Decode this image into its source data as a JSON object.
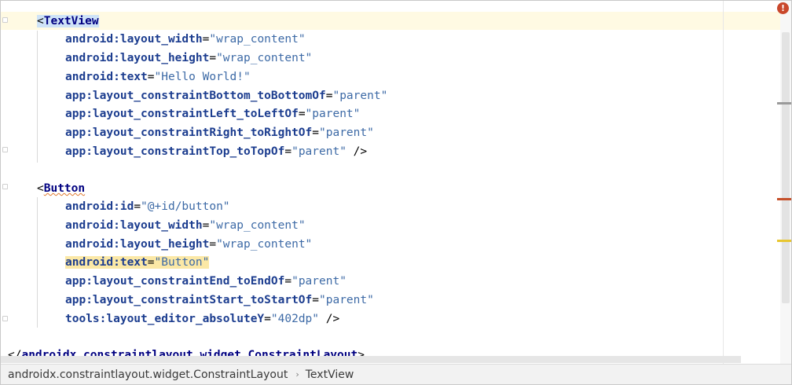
{
  "editor": {
    "textview": {
      "open_tag": "TextView",
      "attrs": [
        {
          "name": "android:layout_width",
          "value": "\"wrap_content\""
        },
        {
          "name": "android:layout_height",
          "value": "\"wrap_content\""
        },
        {
          "name": "android:text",
          "value": "\"Hello World!\""
        },
        {
          "name": "app:layout_constraintBottom_toBottomOf",
          "value": "\"parent\""
        },
        {
          "name": "app:layout_constraintLeft_toLeftOf",
          "value": "\"parent\""
        },
        {
          "name": "app:layout_constraintRight_toRightOf",
          "value": "\"parent\""
        },
        {
          "name": "app:layout_constraintTop_toTopOf",
          "value": "\"parent\"",
          "close": " />"
        }
      ]
    },
    "button": {
      "open_tag": "Button",
      "attrs": [
        {
          "name": "android:id",
          "value": "\"@+id/button\""
        },
        {
          "name": "android:layout_width",
          "value": "\"wrap_content\""
        },
        {
          "name": "android:layout_height",
          "value": "\"wrap_content\""
        },
        {
          "name": "android:text",
          "value": "\"Button\""
        },
        {
          "name": "app:layout_constraintEnd_toEndOf",
          "value": "\"parent\""
        },
        {
          "name": "app:layout_constraintStart_toStartOf",
          "value": "\"parent\""
        },
        {
          "name": "tools:layout_editor_absoluteY",
          "value": "\"402dp\"",
          "close": " />"
        }
      ]
    },
    "closing_tag": "androidx.constraintlayout.widget.ConstraintLayout",
    "error_glyph": "!"
  },
  "breadcrumb": {
    "items": [
      "androidx.constraintlayout.widget.ConstraintLayout",
      "TextView"
    ],
    "separator": "›"
  },
  "colors": {
    "tag": "#000080",
    "attribute": "#1c3d8f",
    "value": "#3d6aa6",
    "current_line": "#fffae3",
    "highlight": "#fbe8a6",
    "error": "#c9472b"
  }
}
